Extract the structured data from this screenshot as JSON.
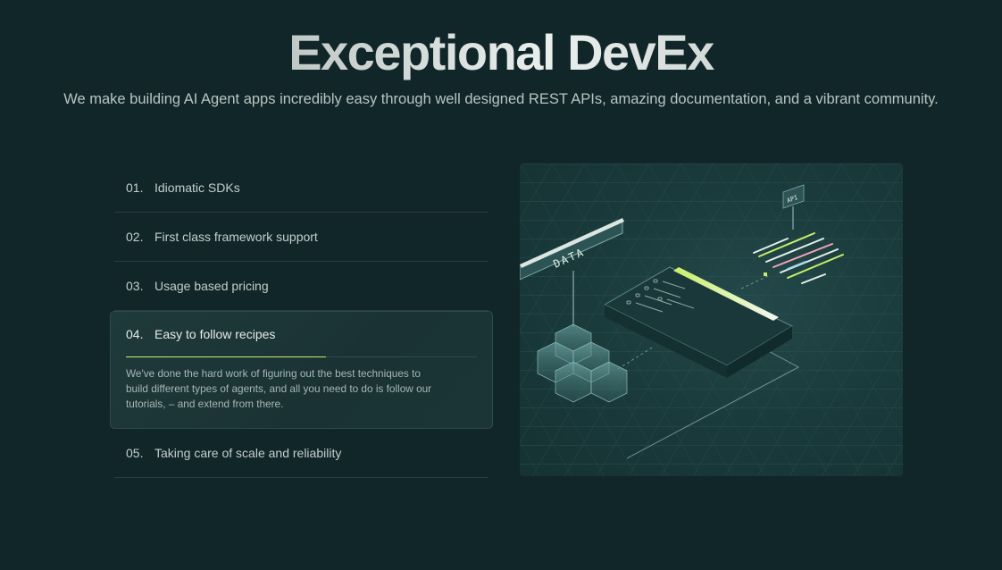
{
  "hero": {
    "title": "Exceptional DevEx",
    "subtitle": "We make building AI Agent apps incredibly easy through well designed REST APIs, amazing documentation, and a vibrant community."
  },
  "features": [
    {
      "num": "01.",
      "label": "Idiomatic SDKs"
    },
    {
      "num": "02.",
      "label": "First class framework support"
    },
    {
      "num": "03.",
      "label": "Usage based pricing"
    },
    {
      "num": "04.",
      "label": "Easy to follow recipes",
      "description": "We've done the hard work of figuring out the best techniques to build different types of agents, and all you need to do is follow our tutorials, – and extend from there.",
      "progress": 0.57
    },
    {
      "num": "05.",
      "label": "Taking care of scale and reliability"
    }
  ],
  "illustration": {
    "data_label": "DATA",
    "api_label": "API"
  },
  "colors": {
    "background": "#112628",
    "accent": "#c8ef6a"
  }
}
